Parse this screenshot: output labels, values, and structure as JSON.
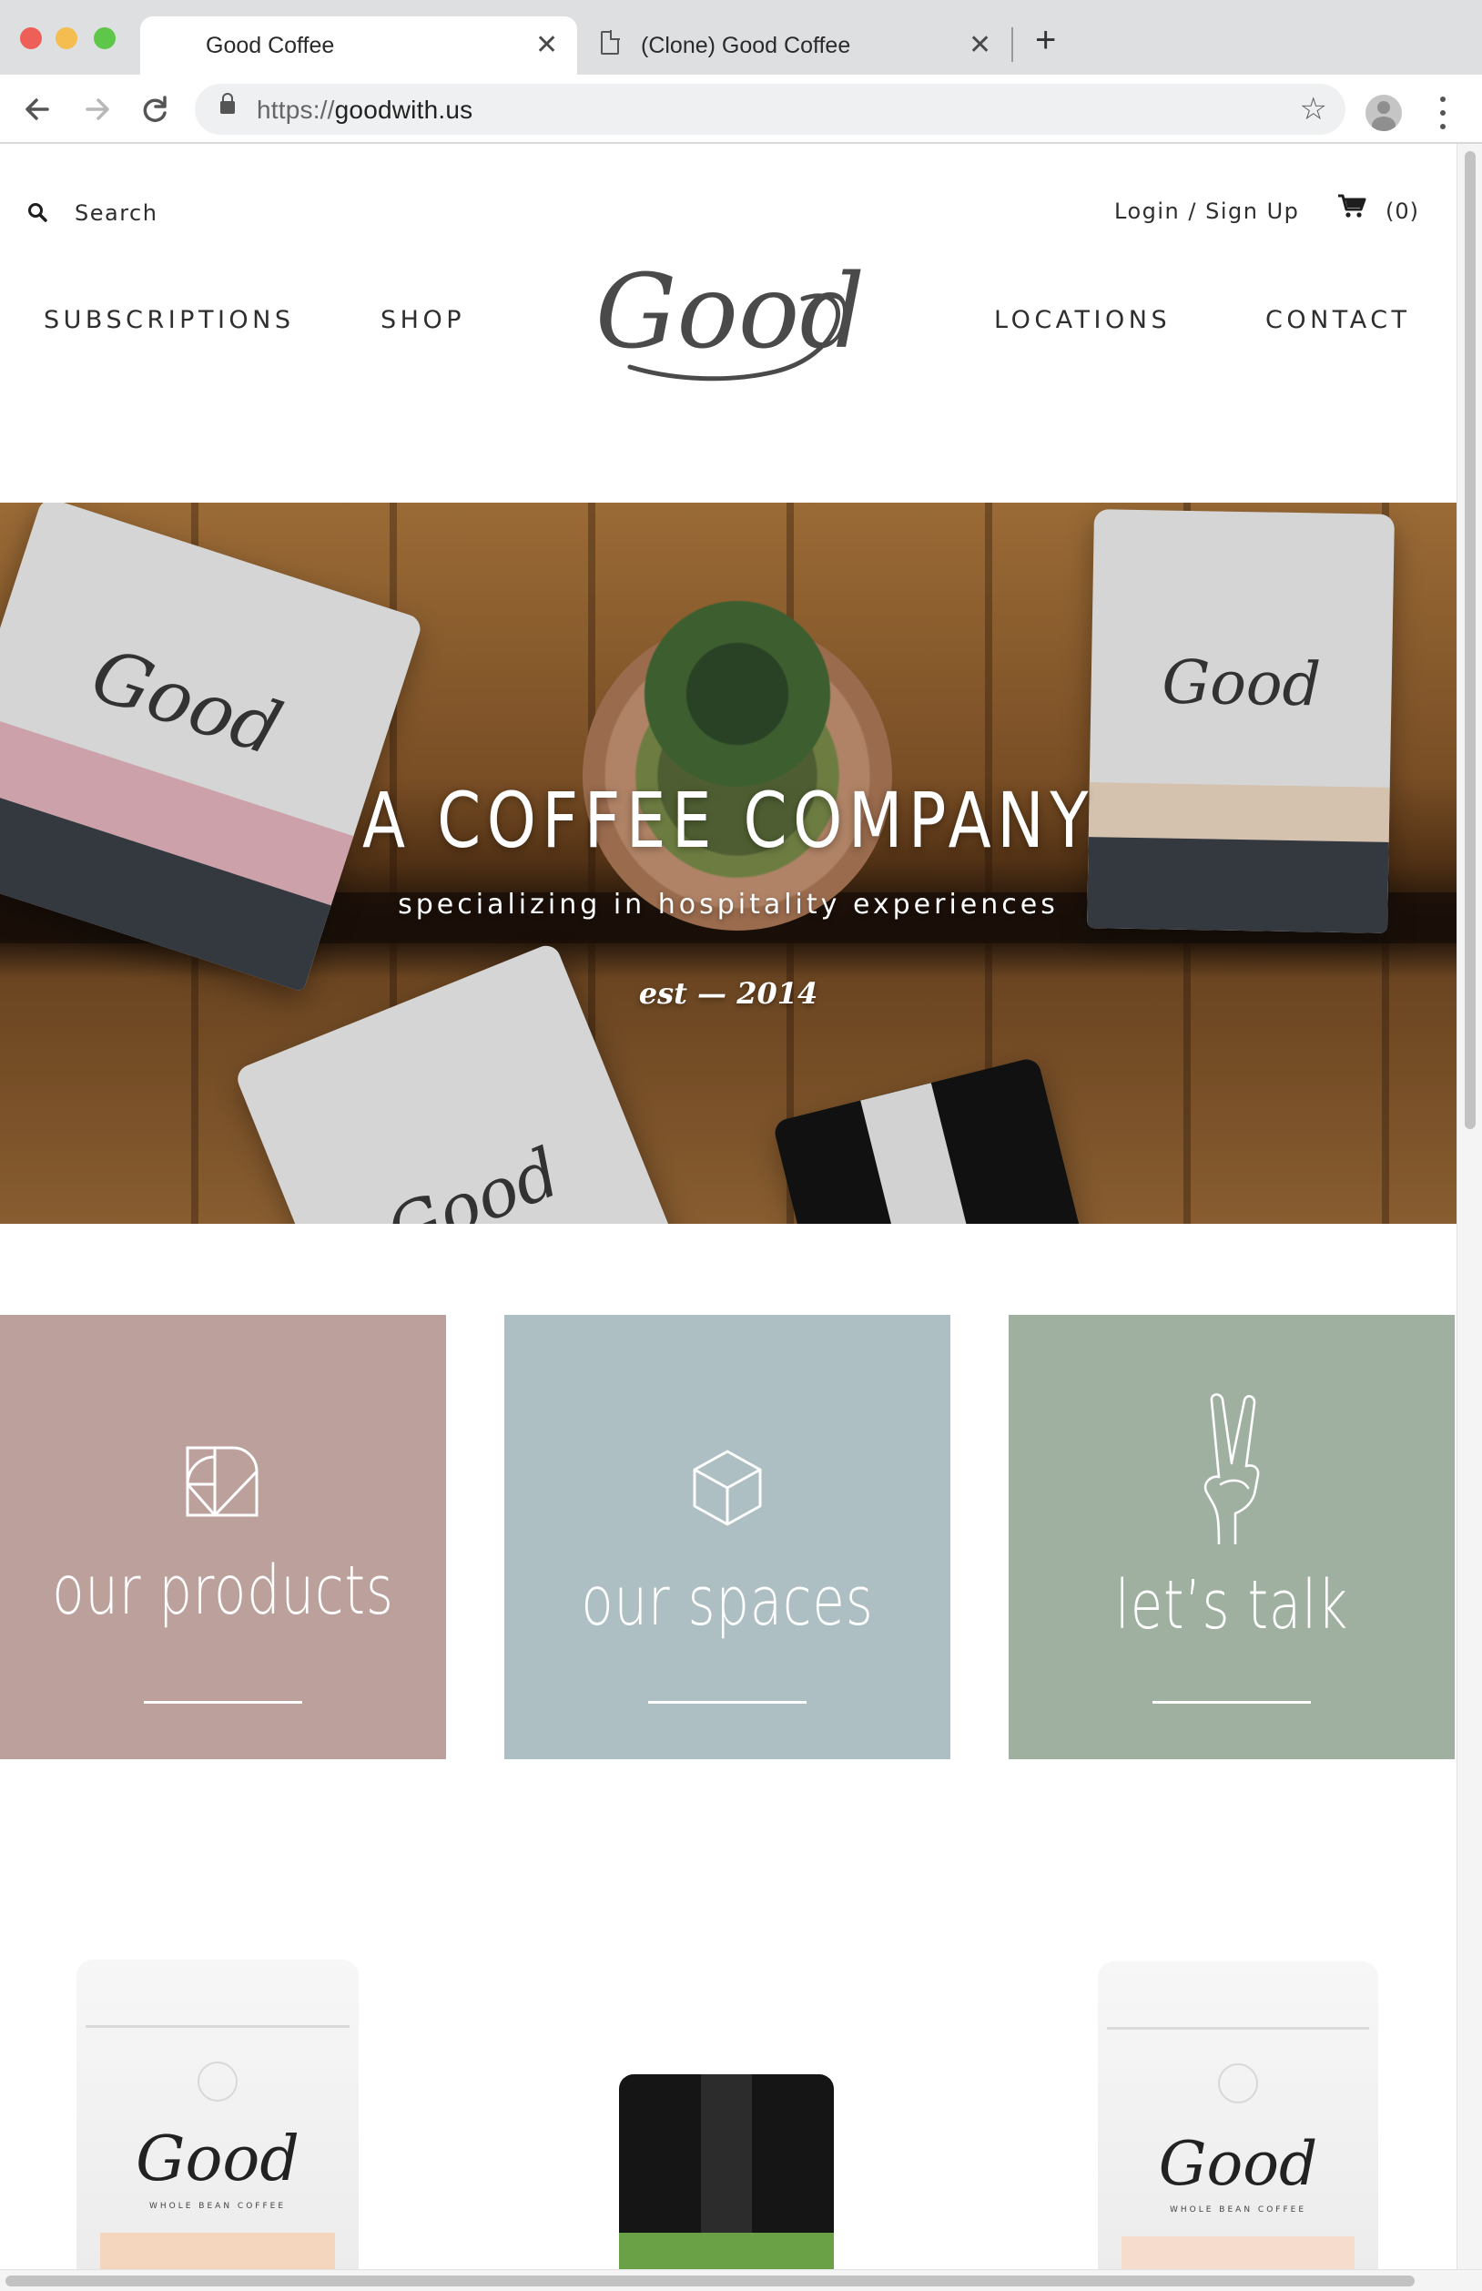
{
  "browser": {
    "tabs": [
      {
        "title": "Good Coffee",
        "active": true
      },
      {
        "title": "(Clone) Good Coffee",
        "active": false
      }
    ],
    "url_scheme": "https://",
    "url_host": "goodwith.us",
    "new_tab_glyph": "+",
    "close_glyph": "✕",
    "icons": {
      "back": "arrow-left-icon",
      "forward": "arrow-right-icon",
      "reload": "reload-icon",
      "lock": "lock-icon",
      "star": "star-icon",
      "profile": "profile-icon",
      "menu": "kebab-menu-icon"
    }
  },
  "header": {
    "search_label": "Search",
    "login_label": "Login / Sign Up",
    "cart_count": "(0)",
    "logo_text": "Good",
    "nav": {
      "subscriptions": "SUBSCRIPTIONS",
      "shop": "SHOP",
      "locations": "LOCATIONS",
      "contact": "CONTACT"
    }
  },
  "hero": {
    "title": "A COFFEE COMPANY",
    "subtitle": "specializing in hospitality experiences",
    "est": "est — 2014",
    "bag_logo": "Good"
  },
  "tiles": [
    {
      "label": "our products",
      "color": "#bca09c",
      "icon": "geometric-shapes-icon"
    },
    {
      "label": "our spaces",
      "color": "#adbfc2",
      "icon": "cube-icon"
    },
    {
      "label": "let’s talk",
      "color": "#9fb0a0",
      "icon": "peace-hand-icon"
    }
  ],
  "products": {
    "logo_text": "Good",
    "bag_caption": "WHOLE BEAN COFFEE"
  },
  "colors": {
    "text": "#2e2e2e",
    "logo": "#4a4a4a"
  }
}
